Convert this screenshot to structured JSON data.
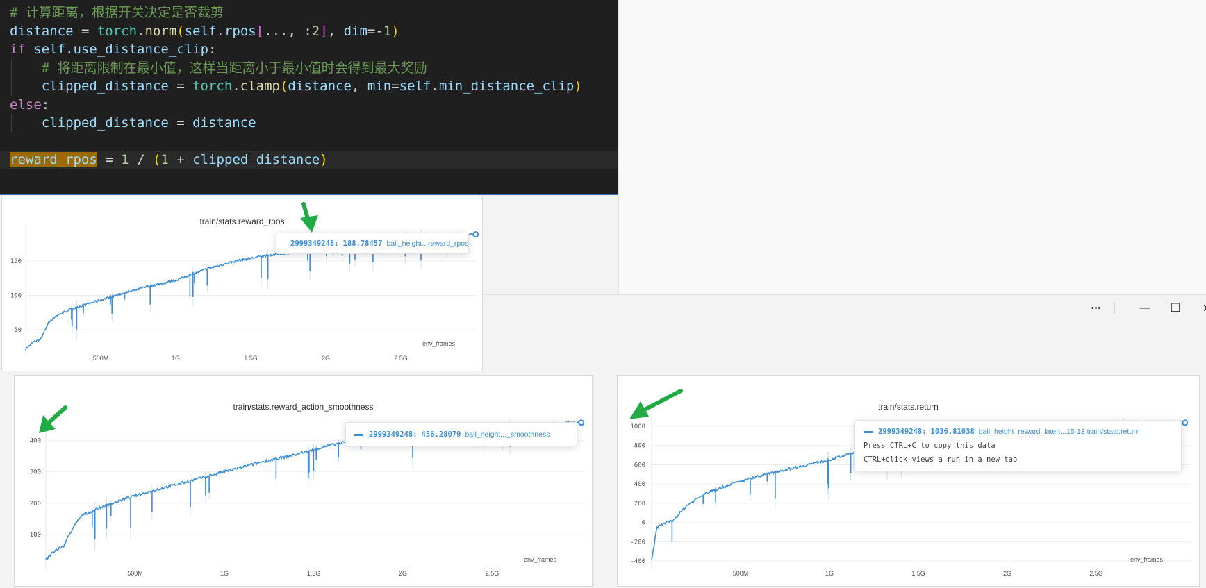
{
  "editor": {
    "lines": [
      {
        "indent": 0,
        "tokens": [
          {
            "t": "# 计算距离，根据开关决定是否裁剪",
            "c": "comment"
          }
        ]
      },
      {
        "indent": 0,
        "tokens": [
          {
            "t": "distance",
            "c": "var"
          },
          {
            "t": " = ",
            "c": "op"
          },
          {
            "t": "torch",
            "c": "cls"
          },
          {
            "t": ".",
            "c": "op"
          },
          {
            "t": "norm",
            "c": "fn"
          },
          {
            "t": "(",
            "c": "b1"
          },
          {
            "t": "self",
            "c": "var"
          },
          {
            "t": ".",
            "c": "op"
          },
          {
            "t": "rpos",
            "c": "var"
          },
          {
            "t": "[",
            "c": "b2"
          },
          {
            "t": "..., :",
            "c": "op"
          },
          {
            "t": "2",
            "c": "num"
          },
          {
            "t": "]",
            "c": "b2"
          },
          {
            "t": ", ",
            "c": "op"
          },
          {
            "t": "dim",
            "c": "var"
          },
          {
            "t": "=-",
            "c": "op"
          },
          {
            "t": "1",
            "c": "num"
          },
          {
            "t": ")",
            "c": "b1"
          }
        ]
      },
      {
        "indent": 0,
        "tokens": [
          {
            "t": "if",
            "c": "kw"
          },
          {
            "t": " self",
            "c": "var"
          },
          {
            "t": ".",
            "c": "op"
          },
          {
            "t": "use_distance_clip",
            "c": "var"
          },
          {
            "t": ":",
            "c": "op"
          }
        ]
      },
      {
        "indent": 1,
        "tokens": [
          {
            "t": "    # 将距离限制在最小值，这样当距离小于最小值时会得到最大奖励",
            "c": "comment"
          }
        ]
      },
      {
        "indent": 1,
        "tokens": [
          {
            "t": "    clipped_distance",
            "c": "var"
          },
          {
            "t": " = ",
            "c": "op"
          },
          {
            "t": "torch",
            "c": "cls"
          },
          {
            "t": ".",
            "c": "op"
          },
          {
            "t": "clamp",
            "c": "fn"
          },
          {
            "t": "(",
            "c": "b1"
          },
          {
            "t": "distance",
            "c": "var"
          },
          {
            "t": ", ",
            "c": "op"
          },
          {
            "t": "min",
            "c": "var"
          },
          {
            "t": "=",
            "c": "op"
          },
          {
            "t": "self",
            "c": "var"
          },
          {
            "t": ".",
            "c": "op"
          },
          {
            "t": "min_distance_clip",
            "c": "var"
          },
          {
            "t": ")",
            "c": "b1"
          }
        ]
      },
      {
        "indent": 0,
        "tokens": [
          {
            "t": "else",
            "c": "kw"
          },
          {
            "t": ":",
            "c": "op"
          }
        ]
      },
      {
        "indent": 1,
        "tokens": [
          {
            "t": "    clipped_distance",
            "c": "var"
          },
          {
            "t": " = ",
            "c": "op"
          },
          {
            "t": "distance",
            "c": "var"
          }
        ]
      },
      {
        "indent": 0,
        "tokens": []
      },
      {
        "indent": 0,
        "current": true,
        "tokens": [
          {
            "t": "reward_rpos",
            "c": "hl"
          },
          {
            "t": " = ",
            "c": "op"
          },
          {
            "t": "1",
            "c": "num"
          },
          {
            "t": " / ",
            "c": "op"
          },
          {
            "t": "(",
            "c": "b1"
          },
          {
            "t": "1",
            "c": "num"
          },
          {
            "t": " + ",
            "c": "op"
          },
          {
            "t": "clipped_distance",
            "c": "var"
          },
          {
            "t": ")",
            "c": "b1"
          }
        ]
      }
    ]
  },
  "window": {
    "more_icon": "ellipsis-icon",
    "more": "•••",
    "minimize": "—",
    "maximize": "☐",
    "close": "✕"
  },
  "colors": {
    "series": "#3b8ed8",
    "annotation_arrow": "#22aa44",
    "code_bg": "#1f1f1f"
  },
  "chart_data": [
    {
      "type": "line",
      "title": "train/stats.reward_rpos",
      "xlabel": "env_frames",
      "xticks": [
        {
          "v": 0.5,
          "label": "500M"
        },
        {
          "v": 1,
          "label": "1G"
        },
        {
          "v": 1.5,
          "label": "1.5G"
        },
        {
          "v": 2,
          "label": "2G"
        },
        {
          "v": 2.5,
          "label": "2.5G"
        }
      ],
      "yticks": [
        50,
        100,
        150
      ],
      "xlim": [
        0,
        3
      ],
      "ylim": [
        20,
        192
      ],
      "grid": true,
      "x": [
        0,
        0.05,
        0.1,
        0.15,
        0.2,
        0.3,
        0.45,
        0.6,
        0.8,
        1.0,
        1.2,
        1.4,
        1.6,
        1.8,
        2.0,
        2.2,
        2.5,
        2.8,
        2.999
      ],
      "y": [
        22,
        32,
        36,
        60,
        70,
        80,
        90,
        100,
        112,
        122,
        138,
        150,
        158,
        163,
        172,
        177,
        183,
        186,
        188.78
      ],
      "tooltip": {
        "step": "2999349248:",
        "value": "188.78457",
        "run": "ball_height...reward_rpos"
      }
    },
    {
      "type": "line",
      "title": "train/stats.reward_action_smoothness",
      "xlabel": "env_frames",
      "xticks": [
        {
          "v": 0.5,
          "label": "500M"
        },
        {
          "v": 1,
          "label": "1G"
        },
        {
          "v": 1.5,
          "label": "1.5G"
        },
        {
          "v": 2,
          "label": "2G"
        },
        {
          "v": 2.5,
          "label": "2.5G"
        }
      ],
      "yticks": [
        100,
        200,
        300,
        400
      ],
      "xlim": [
        0,
        3
      ],
      "ylim": [
        0,
        470
      ],
      "grid": true,
      "x": [
        0,
        0.05,
        0.1,
        0.15,
        0.2,
        0.3,
        0.45,
        0.6,
        0.8,
        1.0,
        1.2,
        1.4,
        1.6,
        1.8,
        2.0,
        2.2,
        2.5,
        2.8,
        2.999
      ],
      "y": [
        20,
        50,
        65,
        120,
        160,
        185,
        215,
        240,
        270,
        300,
        330,
        355,
        385,
        410,
        425,
        435,
        445,
        452,
        456.28
      ],
      "tooltip": {
        "step": "2999349248:",
        "value": "456.28079",
        "run": "ball_height..._smoothness"
      }
    },
    {
      "type": "line",
      "title": "train/stats.return",
      "xlabel": "env_frames",
      "xticks": [
        {
          "v": 0.5,
          "label": "500M"
        },
        {
          "v": 1,
          "label": "1G"
        },
        {
          "v": 1.5,
          "label": "1.5G"
        },
        {
          "v": 2,
          "label": "2G"
        },
        {
          "v": 2.5,
          "label": "2.5G"
        }
      ],
      "yticks": [
        -400,
        -200,
        0,
        200,
        400,
        600,
        800,
        1000
      ],
      "xlim": [
        0,
        3
      ],
      "ylim": [
        -420,
        1080
      ],
      "grid": true,
      "x": [
        0,
        0.03,
        0.08,
        0.12,
        0.2,
        0.3,
        0.45,
        0.6,
        0.8,
        1.0,
        1.2,
        1.4,
        1.6,
        1.8,
        2.0,
        2.2,
        2.5,
        2.8,
        2.999
      ],
      "y": [
        -400,
        -50,
        0,
        20,
        180,
        300,
        400,
        480,
        570,
        650,
        760,
        840,
        880,
        920,
        960,
        980,
        1005,
        1025,
        1036.81
      ],
      "tooltip": {
        "step": "2999349248:",
        "value": "1036.81038",
        "run": "ball_height_reward_laten...15-13 train/stats.return",
        "hints": [
          "Press CTRL+C to copy this data",
          "CTRL+click views a run in a new tab"
        ]
      }
    }
  ]
}
